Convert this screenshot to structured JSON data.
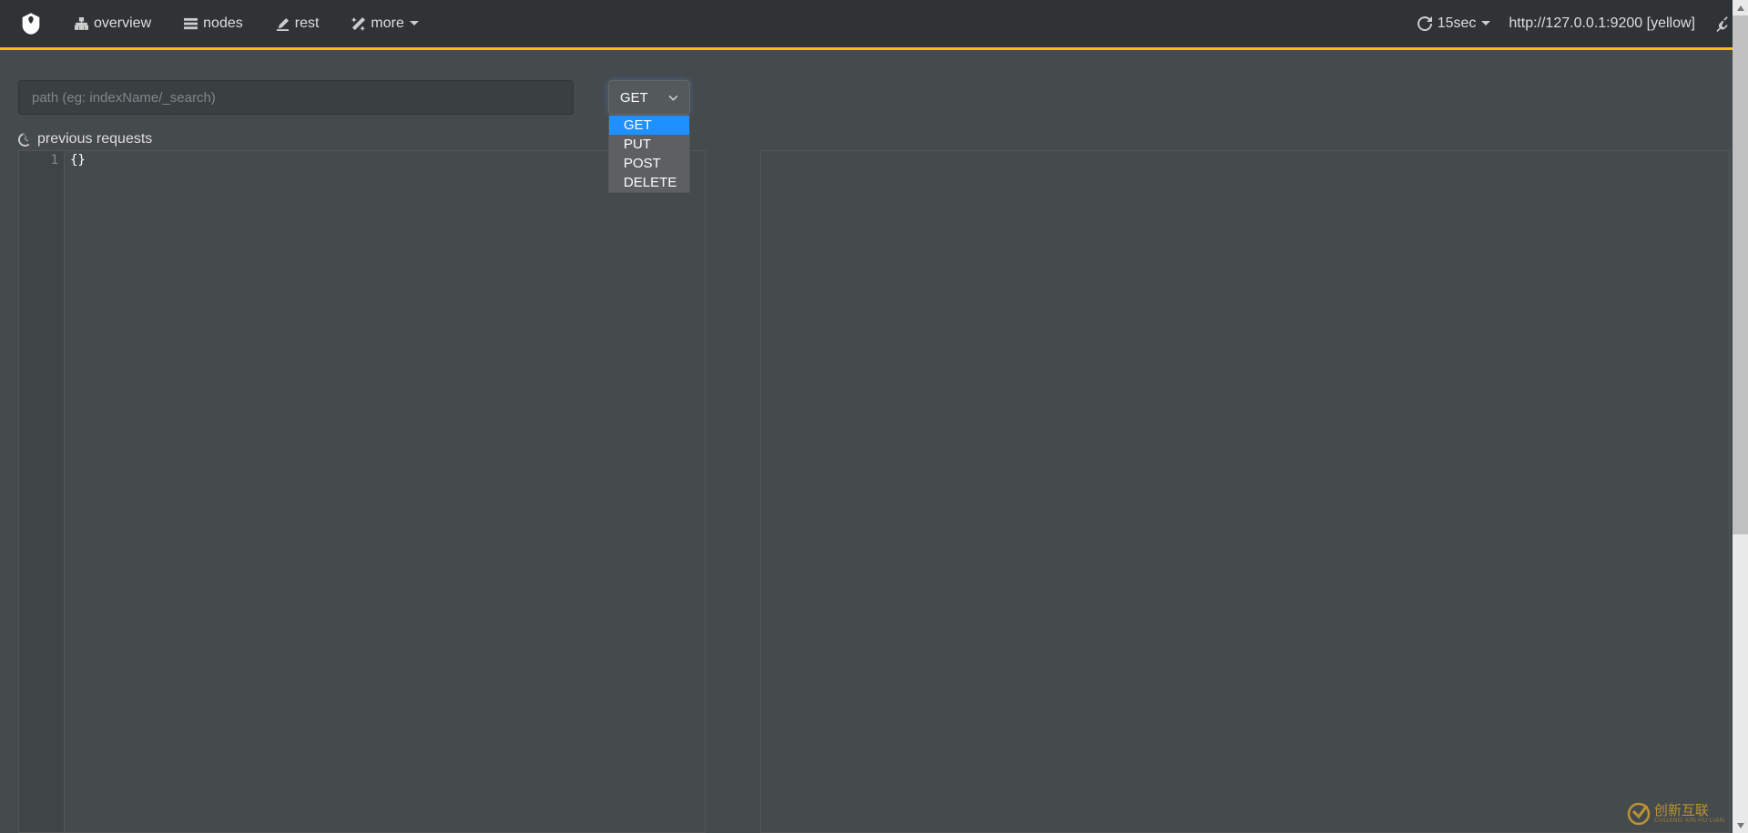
{
  "nav": {
    "items": [
      {
        "label": "overview",
        "icon": "sitemap"
      },
      {
        "label": "nodes",
        "icon": "list"
      },
      {
        "label": "rest",
        "icon": "edit"
      },
      {
        "label": "more",
        "icon": "magic",
        "dropdown": true
      }
    ],
    "refresh": {
      "label": "15sec"
    },
    "host": "http://127.0.0.1:9200 [yellow]"
  },
  "path": {
    "placeholder": "path (eg: indexName/_search)",
    "value": ""
  },
  "method": {
    "selected": "GET",
    "options": [
      "GET",
      "PUT",
      "POST",
      "DELETE"
    ]
  },
  "prevRequests": {
    "label": "previous requests"
  },
  "editor": {
    "lineNum": "1",
    "content": "{}"
  },
  "watermark": {
    "main": "创新互联",
    "sub": "CHUANG XIN HU LIAN"
  }
}
